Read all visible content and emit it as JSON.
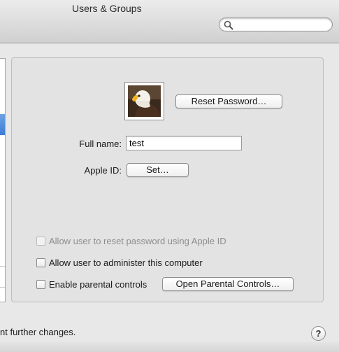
{
  "window": {
    "title": "Users & Groups"
  },
  "search": {
    "placeholder": "",
    "value": ""
  },
  "user": {
    "reset_password_label": "Reset Password…",
    "full_name_label": "Full name:",
    "full_name_value": "test",
    "apple_id_label": "Apple ID:",
    "apple_id_button": "Set…"
  },
  "options": {
    "reset_with_apple_id": {
      "label": "Allow user to reset password using Apple ID",
      "checked": false,
      "disabled": true
    },
    "administer": {
      "label": "Allow user to administer this computer",
      "checked": false
    },
    "parental": {
      "label": "Enable parental controls",
      "checked": false
    },
    "open_parental_label": "Open Parental Controls…"
  },
  "footer": {
    "lock_text": "nt further changes.",
    "help_label": "?"
  },
  "colors": {
    "selection": "#3d7bd5"
  },
  "icons": {
    "avatar": "bald-eagle-icon",
    "search": "magnifier-icon"
  }
}
